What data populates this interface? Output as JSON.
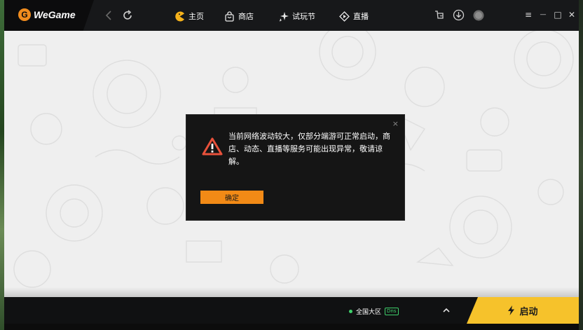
{
  "app": {
    "logo_letter": "G",
    "logo_text": "WeGame"
  },
  "nav": {
    "back_icon": "chevron-left-icon",
    "refresh_icon": "refresh-icon",
    "items": [
      {
        "label": "主页",
        "icon": "pac-home-icon"
      },
      {
        "label": "商店",
        "icon": "shopping-bag-icon"
      },
      {
        "label": "试玩节",
        "icon": "sparkle-icon"
      },
      {
        "label": "直播",
        "icon": "play-diamond-icon"
      }
    ]
  },
  "window_buttons": {
    "menu": "≡",
    "minimize": "—",
    "maximize": "□",
    "close": "✕"
  },
  "dialog": {
    "close": "×",
    "message": "当前网络波动较大，仅部分端游可正常启动，商店、动态、直播等服务可能出现异常，敬请谅解。",
    "confirm_label": "确定"
  },
  "footer": {
    "region_label": "全国大区",
    "region_badge": "Dns",
    "chevron": "︿",
    "launch_label": "启动"
  },
  "colors": {
    "accent": "#f28a16",
    "launch": "#f6c22b",
    "region_status": "#3fd06b",
    "topbar": "#17181a"
  }
}
